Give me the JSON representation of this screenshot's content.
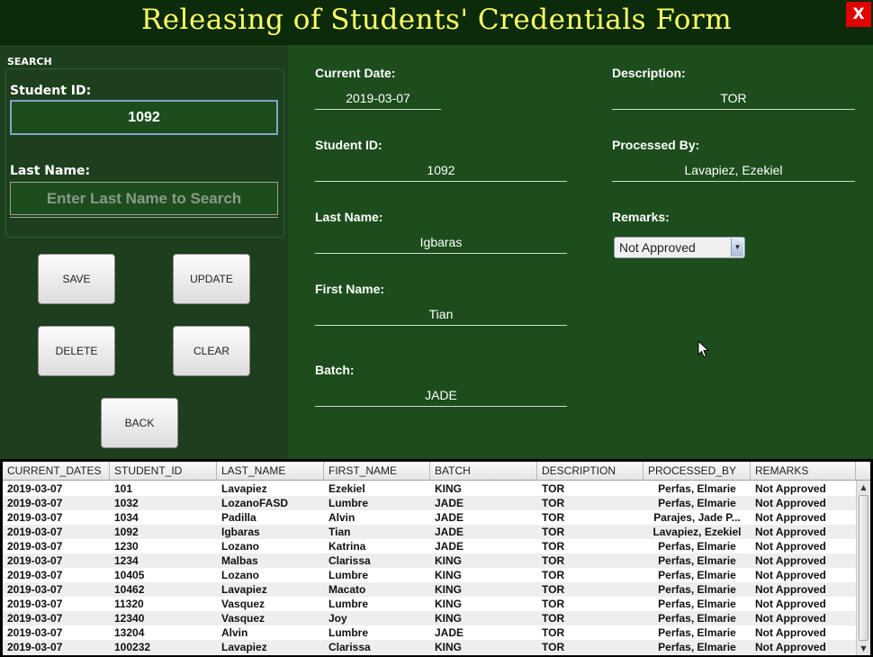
{
  "window": {
    "title": "Releasing of Students' Credentials Form",
    "close_label": "X"
  },
  "search": {
    "section_title": "SEARCH",
    "student_id_label": "Student ID:",
    "student_id_value": "1092",
    "last_name_label": "Last Name:",
    "last_name_placeholder": "Enter Last Name to Search"
  },
  "buttons": {
    "save": "SAVE",
    "update": "UPDATE",
    "delete": "DELETE",
    "clear": "CLEAR",
    "back": "BACK"
  },
  "form": {
    "current_date_label": "Current Date:",
    "current_date": "2019-03-07",
    "student_id_label": "Student ID:",
    "student_id": "1092",
    "last_name_label": "Last Name:",
    "last_name": "Igbaras",
    "first_name_label": "First Name:",
    "first_name": "Tian",
    "batch_label": "Batch:",
    "batch": "JADE",
    "description_label": "Description:",
    "description": "TOR",
    "processed_by_label": "Processed By:",
    "processed_by": "Lavapiez, Ezekiel",
    "remarks_label": "Remarks:",
    "remarks_selected": "Not Approved"
  },
  "table": {
    "columns": [
      "CURRENT_DATES",
      "STUDENT_ID",
      "LAST_NAME",
      "FIRST_NAME",
      "BATCH",
      "DESCRIPTION",
      "PROCESSED_BY",
      "REMARKS"
    ],
    "rows": [
      [
        "2019-03-07",
        "101",
        "Lavapiez",
        "Ezekiel",
        "KING",
        "TOR",
        "Perfas, Elmarie",
        "Not Approved"
      ],
      [
        "2019-03-07",
        "1032",
        "LozanoFASD",
        "Lumbre",
        "JADE",
        "TOR",
        "Perfas, Elmarie",
        "Not Approved"
      ],
      [
        "2019-03-07",
        "1034",
        "Padilla",
        "Alvin",
        "JADE",
        "TOR",
        "Parajes, Jade P...",
        "Not Approved"
      ],
      [
        "2019-03-07",
        "1092",
        "Igbaras",
        "Tian",
        "JADE",
        "TOR",
        "Lavapiez, Ezekiel",
        "Not Approved"
      ],
      [
        "2019-03-07",
        "1230",
        "Lozano",
        "Katrina",
        "JADE",
        "TOR",
        "Perfas, Elmarie",
        "Not Approved"
      ],
      [
        "2019-03-07",
        "1234",
        "Malbas",
        "Clarissa",
        "KING",
        "TOR",
        "Perfas, Elmarie",
        "Not Approved"
      ],
      [
        "2019-03-07",
        "10405",
        "Lozano",
        "Lumbre",
        "KING",
        "TOR",
        "Perfas, Elmarie",
        "Not Approved"
      ],
      [
        "2019-03-07",
        "10462",
        "Lavapiez",
        "Macato",
        "KING",
        "TOR",
        "Perfas, Elmarie",
        "Not Approved"
      ],
      [
        "2019-03-07",
        "11320",
        "Vasquez",
        "Lumbre",
        "KING",
        "TOR",
        "Perfas, Elmarie",
        "Not Approved"
      ],
      [
        "2019-03-07",
        "12340",
        "Vasquez",
        "Joy",
        "KING",
        "TOR",
        "Perfas, Elmarie",
        "Not Approved"
      ],
      [
        "2019-03-07",
        "13204",
        "Alvin",
        "Lumbre",
        "JADE",
        "TOR",
        "Perfas, Elmarie",
        "Not Approved"
      ],
      [
        "2019-03-07",
        "100232",
        "Lavapiez",
        "Clarissa",
        "KING",
        "TOR",
        "Perfas, Elmarie",
        "Not Approved"
      ]
    ]
  },
  "colors": {
    "title": "#ffff66",
    "panel_left": "#1e3f1e",
    "panel_right": "#1d4d1d",
    "close": "#e00000"
  }
}
